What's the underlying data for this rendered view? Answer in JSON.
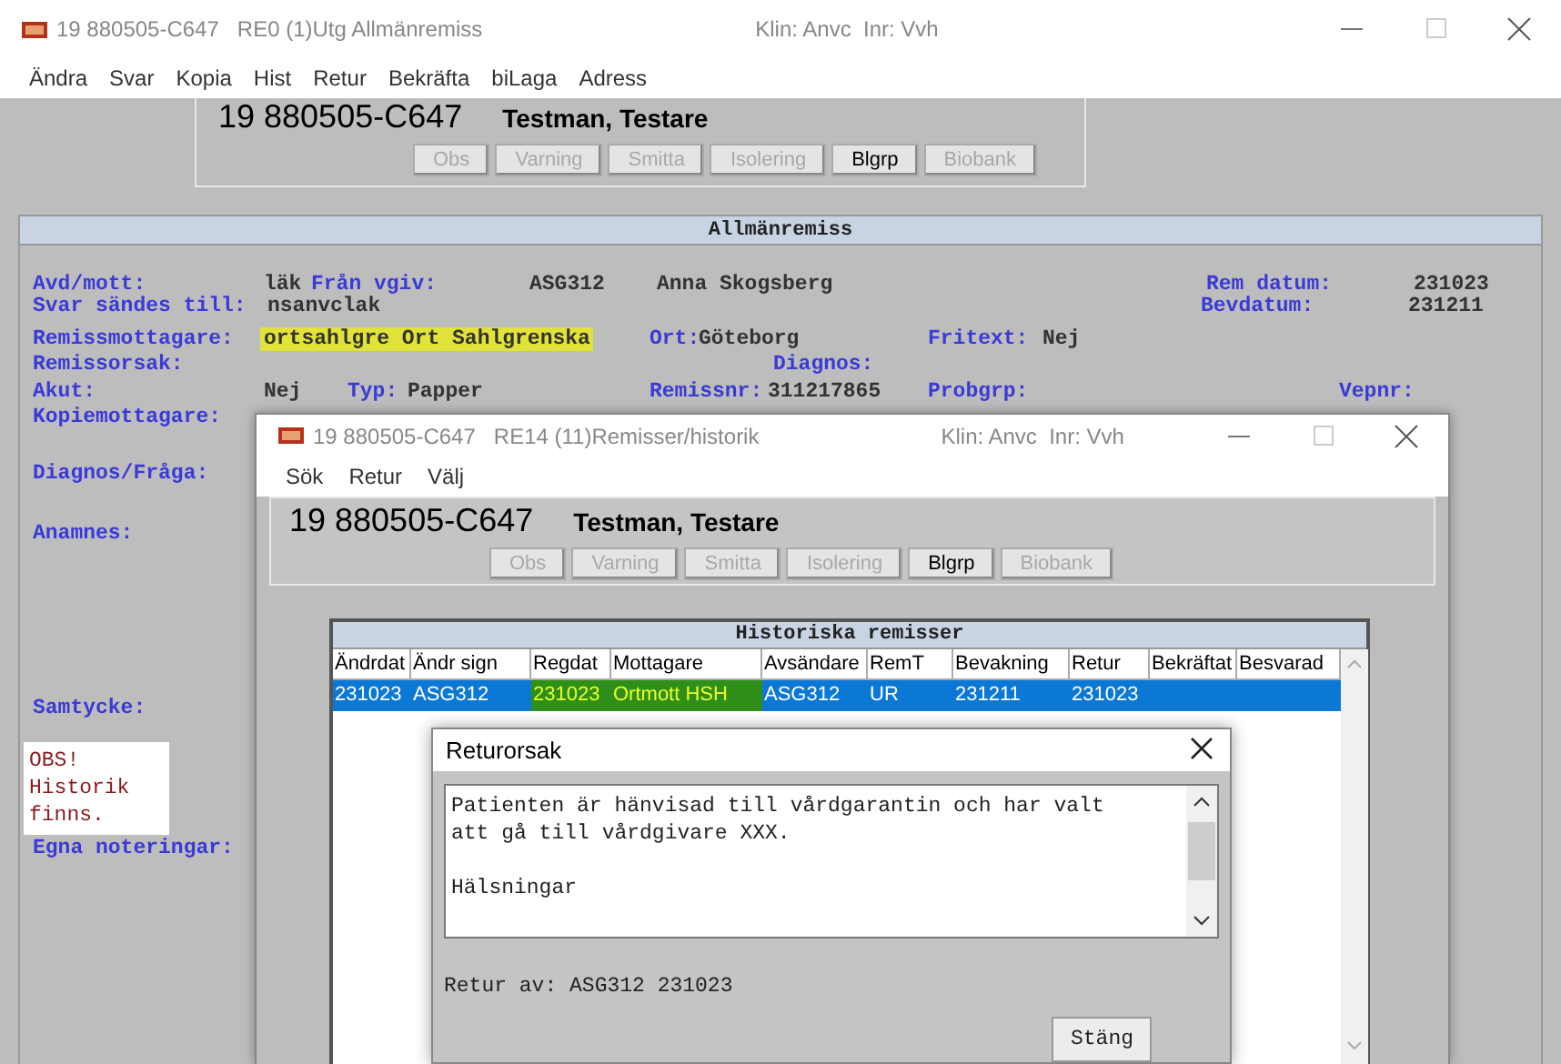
{
  "main_window": {
    "title": "19 880505-C647   RE0 (1)Utg Allmänremiss",
    "context": "Klin: Anvc  Inr: Vvh",
    "menu": [
      "Ändra",
      "Svar",
      "Kopia",
      "Hist",
      "Retur",
      "Bekräfta",
      "biLaga",
      "Adress"
    ],
    "patient": {
      "id": "19 880505-C647",
      "name": "Testman, Testare",
      "flags": [
        {
          "label": "Obs",
          "disabled": true
        },
        {
          "label": "Varning",
          "disabled": true
        },
        {
          "label": "Smitta",
          "disabled": true
        },
        {
          "label": "Isolering",
          "disabled": true
        },
        {
          "label": "Blgrp",
          "disabled": false
        },
        {
          "label": "Biobank",
          "disabled": true
        }
      ]
    },
    "referral": {
      "heading": "Allmänremiss",
      "rows": [
        {
          "segments": [
            {
              "kind": "label",
              "text": "Avd/mott:"
            },
            {
              "kind": "value",
              "text": "läk"
            },
            {
              "kind": "label",
              "text": "Från vgiv:"
            },
            {
              "kind": "value",
              "text": "ASG312"
            },
            {
              "kind": "value",
              "text": "Anna Skogsberg"
            },
            {
              "kind": "label",
              "text": "Rem datum:"
            },
            {
              "kind": "value",
              "text": "231023"
            }
          ]
        },
        {
          "segments": [
            {
              "kind": "label",
              "text": "Svar sändes till:"
            },
            {
              "kind": "value",
              "text": "nsanvclak"
            },
            {
              "kind": "label",
              "text": "Bevdatum:"
            },
            {
              "kind": "value",
              "text": "231211"
            }
          ]
        },
        {
          "segments": [
            {
              "kind": "label",
              "text": "Remissmottagare:"
            },
            {
              "kind": "value",
              "text": "ortsahlgre Ort Sahlgrenska",
              "highlighted": true
            },
            {
              "kind": "label",
              "text": "Ort:"
            },
            {
              "kind": "value",
              "text": "Göteborg"
            },
            {
              "kind": "label",
              "text": "Fritext:"
            },
            {
              "kind": "value",
              "text": "Nej"
            }
          ]
        },
        {
          "segments": [
            {
              "kind": "label",
              "text": "Remissorsak:"
            },
            {
              "kind": "label",
              "text": "Diagnos:"
            }
          ]
        },
        {
          "segments": [
            {
              "kind": "label",
              "text": "Akut:"
            },
            {
              "kind": "value",
              "text": "Nej"
            },
            {
              "kind": "label",
              "text": "Typ:"
            },
            {
              "kind": "value",
              "text": "Papper"
            },
            {
              "kind": "label",
              "text": "Remissnr:"
            },
            {
              "kind": "value",
              "text": "311217865"
            },
            {
              "kind": "label",
              "text": "Probgrp:"
            },
            {
              "kind": "label",
              "text": "Vepnr:"
            }
          ]
        },
        {
          "segments": [
            {
              "kind": "label",
              "text": "Kopiemottagare:"
            }
          ]
        }
      ],
      "fields_below": [
        "Diagnos/Fråga:",
        "Anamnes:",
        "Samtycke:"
      ],
      "notice": "OBS!\nHistorik\nfinns.",
      "notes_label": "Egna noteringar:"
    }
  },
  "history_window": {
    "title": "19 880505-C647   RE14 (11)Remisser/historik",
    "context": "Klin: Anvc  Inr: Vvh",
    "menu": [
      "Sök",
      "Retur",
      "Välj"
    ],
    "patient": {
      "id": "19 880505-C647",
      "name": "Testman, Testare",
      "flags": [
        {
          "label": "Obs",
          "disabled": true
        },
        {
          "label": "Varning",
          "disabled": true
        },
        {
          "label": "Smitta",
          "disabled": true
        },
        {
          "label": "Isolering",
          "disabled": true
        },
        {
          "label": "Blgrp",
          "disabled": false
        },
        {
          "label": "Biobank",
          "disabled": true
        }
      ]
    },
    "table": {
      "heading": "Historiska remisser",
      "columns": [
        "Ändrdat",
        "Ändr sign",
        "Regdat",
        "Mottagare",
        "Avsändare",
        "RemT",
        "Bevakning",
        "Retur",
        "Bekräftat",
        "Besvarad"
      ],
      "rows": [
        {
          "selected": true,
          "cells": [
            {
              "text": "231023",
              "highlighted": false
            },
            {
              "text": "ASG312",
              "highlighted": false
            },
            {
              "text": "231023",
              "highlighted": true
            },
            {
              "text": "Ortmott HSH",
              "highlighted": true
            },
            {
              "text": "ASG312",
              "highlighted": false
            },
            {
              "text": "UR",
              "highlighted": false
            },
            {
              "text": "231211",
              "highlighted": false
            },
            {
              "text": "231023",
              "highlighted": false
            }
          ]
        }
      ]
    }
  },
  "dialog": {
    "title": "Returorsak",
    "message": "Patienten är hänvisad till vårdgarantin och har valt\natt gå till vårdgivare XXX.\n\nHälsningar",
    "returned_by": "Retur av: ASG312 231023",
    "buttons": [
      "Stäng"
    ]
  }
}
